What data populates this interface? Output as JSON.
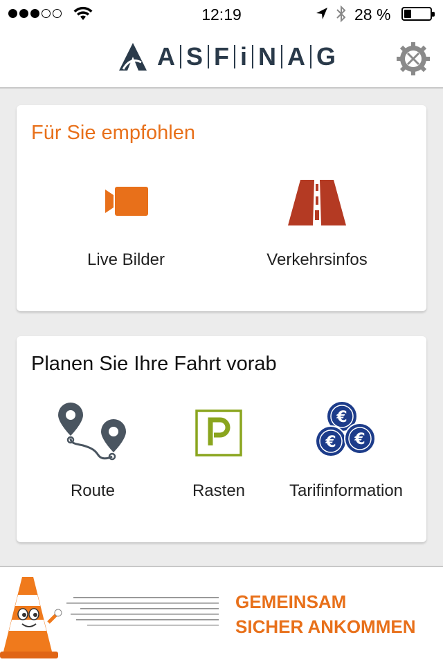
{
  "status_bar": {
    "time": "12:19",
    "battery_text": "28 %",
    "battery_level": 0.28,
    "signal_bars_filled": 3,
    "signal_bars_total": 5
  },
  "header": {
    "logo_letters": [
      "A",
      "S",
      "F",
      "i",
      "N",
      "A",
      "G"
    ],
    "settings_icon": "gear-icon"
  },
  "recommended": {
    "title": "Für Sie empfohlen",
    "items": [
      {
        "label": "Live Bilder",
        "icon": "video-camera-icon"
      },
      {
        "label": "Verkehrsinfos",
        "icon": "road-icon"
      }
    ]
  },
  "plan": {
    "title": "Planen Sie Ihre Fahrt vorab",
    "items": [
      {
        "label": "Route",
        "icon": "route-pins-icon"
      },
      {
        "label": "Rasten",
        "icon": "parking-icon"
      },
      {
        "label": "Tarifinformation",
        "icon": "euro-coins-icon"
      }
    ]
  },
  "banner": {
    "line1": "GEMEINSAM",
    "line2": "SICHER ANKOMMEN"
  },
  "colors": {
    "accent": "#e8701a",
    "road": "#b43a23",
    "parking": "#8aa51e",
    "euro": "#1d3c8a",
    "pin": "#4a5560"
  }
}
